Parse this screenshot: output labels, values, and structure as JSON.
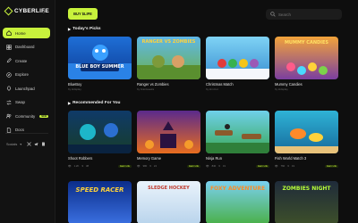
{
  "app": {
    "name": "CYBERLIFE"
  },
  "sidebar": {
    "items": [
      {
        "label": "Home",
        "active": true,
        "icon": "home-icon"
      },
      {
        "label": "Dashboard",
        "icon": "dashboard-icon"
      },
      {
        "label": "Create",
        "icon": "create-icon"
      },
      {
        "label": "Explore",
        "icon": "explore-icon"
      },
      {
        "label": "Launchpad",
        "icon": "launchpad-icon"
      },
      {
        "label": "Swap",
        "icon": "swap-icon"
      },
      {
        "label": "Community",
        "icon": "community-icon",
        "badge": "NEW"
      },
      {
        "label": "Docs",
        "icon": "docs-icon"
      }
    ],
    "bottom_label": "Socials"
  },
  "topbar": {
    "buy_label": "BUY $LIFE",
    "search_placeholder": "Search"
  },
  "sections": {
    "picks_title": "Today's Picks",
    "recommended_title": "Recommended For You"
  },
  "todays_picks": [
    {
      "title": "BlueBoy",
      "sub": "by kidsplay",
      "thumb_text": "BLUE BOY SUMMER"
    },
    {
      "title": "Ranger vs Zombies",
      "sub": "by brainweeks",
      "thumb_text": "RANGER VS ZOMBIES"
    },
    {
      "title": "Christmas Match",
      "sub": "by kim.bot",
      "thumb_text": ""
    },
    {
      "title": "Mummy Candies",
      "sub": "by kidsplay",
      "thumb_text": "MUMMY CANDIES"
    }
  ],
  "recommended": [
    {
      "title": "Shoot Robbers",
      "plays": "1.2K",
      "likes": "38",
      "earn": "Earn Life"
    },
    {
      "title": "Memory Game",
      "plays": "980",
      "likes": "24",
      "earn": "Earn Life"
    },
    {
      "title": "Ninja Run",
      "plays": "840",
      "likes": "31",
      "earn": "Earn Life"
    },
    {
      "title": "Fish World Match 3",
      "plays": "760",
      "likes": "19",
      "earn": "Earn Life"
    }
  ],
  "third_row": [
    {
      "thumb_text": "SPEED RACER"
    },
    {
      "thumb_text": "SLEDGE HOCKEY"
    },
    {
      "thumb_text": "FOXY ADVENTURE"
    },
    {
      "thumb_text": "ZOMBIES NIGHT"
    }
  ],
  "colors": {
    "accent": "#c8f23c",
    "bg": "#0e0e0e",
    "sidebar": "#121212"
  }
}
